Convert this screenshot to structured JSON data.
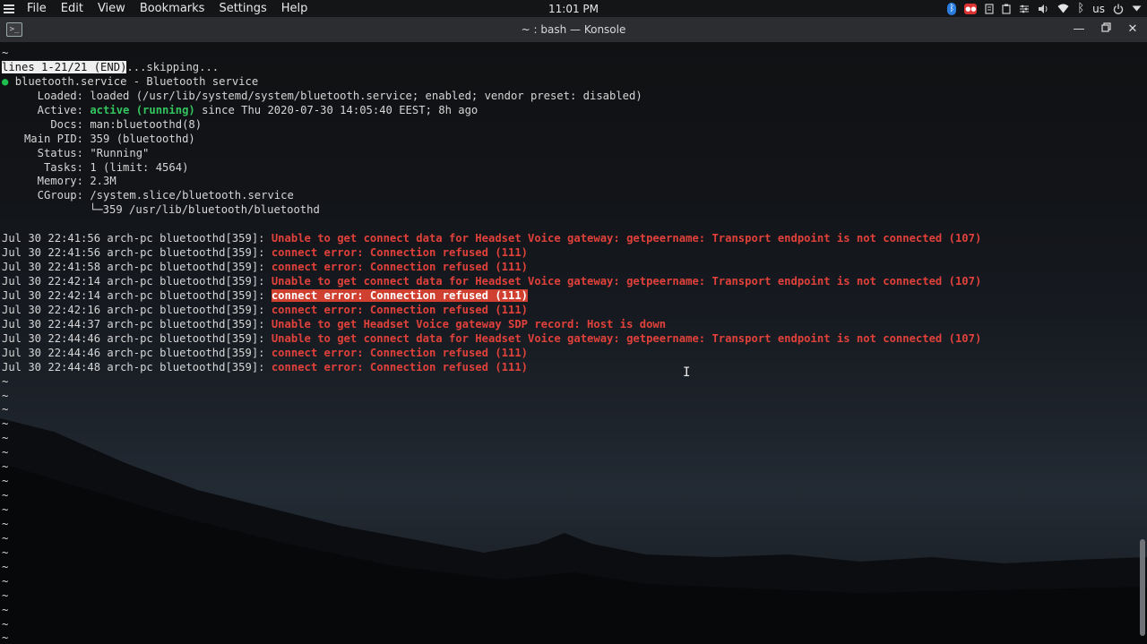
{
  "panel": {
    "menu": [
      "File",
      "Edit",
      "View",
      "Bookmarks",
      "Settings",
      "Help"
    ],
    "clock": "11:01 PM",
    "tray": {
      "icons": [
        "bluetooth-blue-icon",
        "notification-red-icon",
        "notes-icon",
        "clipboard-icon",
        "settings-sliders-icon",
        "volume-icon",
        "wifi-icon",
        "bluetooth-icon"
      ],
      "keyboard_layout": "us"
    }
  },
  "window": {
    "title": "~ : bash — Konsole"
  },
  "terminal": {
    "pager_status": "lines 1-21/21 (END)",
    "skipping": "...skipping...",
    "service_dot": "●",
    "service_title": "bluetooth.service - Bluetooth service",
    "props": [
      {
        "label": "Loaded:",
        "value": "loaded (/usr/lib/systemd/system/bluetooth.service; enabled; vendor preset: disabled)"
      },
      {
        "label": "Active:",
        "value_green": "active (running)",
        "value": "since Thu 2020-07-30 14:05:40 EEST; 8h ago"
      },
      {
        "label": "Docs:",
        "value": "man:bluetoothd(8)"
      },
      {
        "label": "Main PID:",
        "value": "359 (bluetoothd)"
      },
      {
        "label": "Status:",
        "value": "\"Running\""
      },
      {
        "label": "Tasks:",
        "value": "1 (limit: 4564)"
      },
      {
        "label": "Memory:",
        "value": "2.3M"
      },
      {
        "label": "CGroup:",
        "value": "/system.slice/bluetooth.service"
      }
    ],
    "cgroup_child": "└─359 /usr/lib/bluetooth/bluetoothd",
    "logs": [
      {
        "prefix": "Jul 30 22:41:56 arch-pc bluetoothd[359]:",
        "msg": "Unable to get connect data for Headset Voice gateway: getpeername: Transport endpoint is not connected (107)",
        "highlight": false
      },
      {
        "prefix": "Jul 30 22:41:56 arch-pc bluetoothd[359]:",
        "msg": "connect error: Connection refused (111)",
        "highlight": false
      },
      {
        "prefix": "Jul 30 22:41:58 arch-pc bluetoothd[359]:",
        "msg": "connect error: Connection refused (111)",
        "highlight": false
      },
      {
        "prefix": "Jul 30 22:42:14 arch-pc bluetoothd[359]:",
        "msg": "Unable to get connect data for Headset Voice gateway: getpeername: Transport endpoint is not connected (107)",
        "highlight": false
      },
      {
        "prefix": "Jul 30 22:42:14 arch-pc bluetoothd[359]:",
        "msg": "connect error: Connection refused (111)",
        "highlight": true
      },
      {
        "prefix": "Jul 30 22:42:16 arch-pc bluetoothd[359]:",
        "msg": "connect error: Connection refused (111)",
        "highlight": false
      },
      {
        "prefix": "Jul 30 22:44:37 arch-pc bluetoothd[359]:",
        "msg": "Unable to get Headset Voice gateway SDP record: Host is down",
        "highlight": false
      },
      {
        "prefix": "Jul 30 22:44:46 arch-pc bluetoothd[359]:",
        "msg": "Unable to get connect data for Headset Voice gateway: getpeername: Transport endpoint is not connected (107)",
        "highlight": false
      },
      {
        "prefix": "Jul 30 22:44:46 arch-pc bluetoothd[359]:",
        "msg": "connect error: Connection refused (111)",
        "highlight": false
      },
      {
        "prefix": "Jul 30 22:44:48 arch-pc bluetoothd[359]:",
        "msg": "connect error: Connection refused (111)",
        "highlight": false
      }
    ],
    "tilde": "~",
    "tilde_count": 19,
    "colors": {
      "error_red": "#e0413a",
      "active_green": "#34c55f",
      "highlight_bg": "#d04030"
    }
  }
}
